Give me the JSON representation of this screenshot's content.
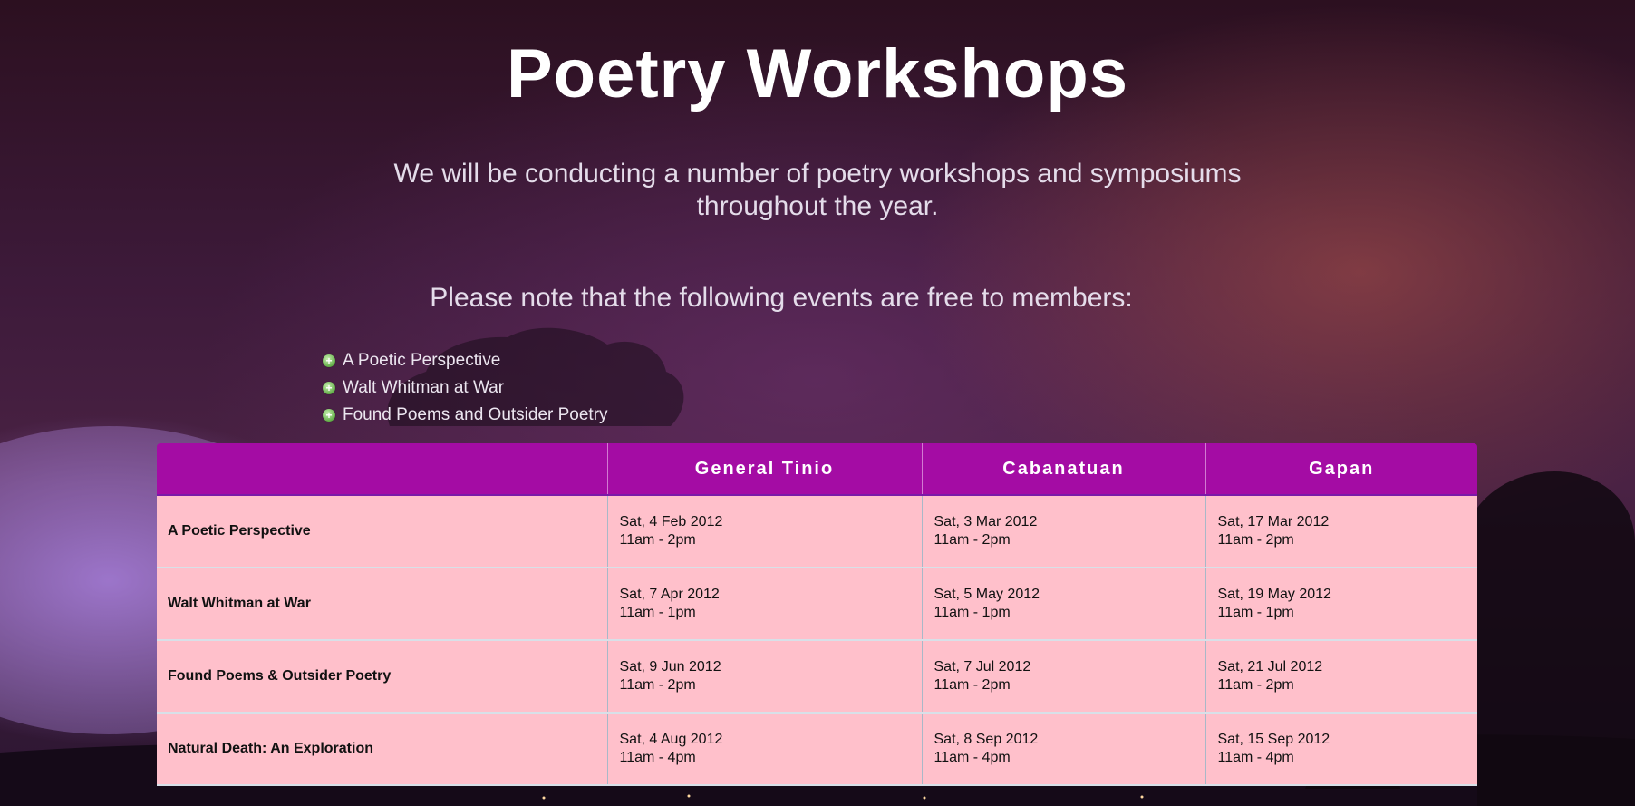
{
  "page": {
    "title": "Poetry Workshops",
    "intro": "We will be conducting a number of poetry workshops and symposiums throughout the year.",
    "note": "Please note that the following events are free to members:"
  },
  "free_events": [
    {
      "label": "A Poetic Perspective",
      "icon": "plus-circle-icon"
    },
    {
      "label": "Walt Whitman at War",
      "icon": "plus-circle-icon"
    },
    {
      "label": "Found Poems and Outsider Poetry",
      "icon": "plus-circle-icon"
    }
  ],
  "schedule": {
    "columns": [
      "",
      "General Tinio",
      "Cabanatuan",
      "Gapan"
    ],
    "rows": [
      {
        "event": "A Poetic Perspective",
        "cells": [
          {
            "date": "Sat, 4 Feb 2012",
            "time": "11am - 2pm"
          },
          {
            "date": "Sat, 3 Mar 2012",
            "time": "11am - 2pm"
          },
          {
            "date": "Sat, 17 Mar 2012",
            "time": "11am - 2pm"
          }
        ]
      },
      {
        "event": "Walt Whitman at War",
        "cells": [
          {
            "date": "Sat, 7 Apr 2012",
            "time": "11am - 1pm"
          },
          {
            "date": "Sat, 5 May 2012",
            "time": "11am - 1pm"
          },
          {
            "date": "Sat, 19 May 2012",
            "time": "11am - 1pm"
          }
        ]
      },
      {
        "event": "Found Poems & Outsider Poetry",
        "cells": [
          {
            "date": "Sat, 9 Jun 2012",
            "time": "11am - 2pm"
          },
          {
            "date": "Sat, 7 Jul 2012",
            "time": "11am - 2pm"
          },
          {
            "date": "Sat, 21 Jul 2012",
            "time": "11am - 2pm"
          }
        ]
      },
      {
        "event": "Natural Death: An Exploration",
        "cells": [
          {
            "date": "Sat, 4 Aug 2012",
            "time": "11am - 4pm"
          },
          {
            "date": "Sat, 8 Sep 2012",
            "time": "11am - 4pm"
          },
          {
            "date": "Sat, 15 Sep 2012",
            "time": "11am - 4pm"
          }
        ]
      }
    ]
  },
  "colors": {
    "header_purple": "#a40ca4",
    "cell_pink": "#ffc0cb",
    "title_white": "#ffffff"
  }
}
